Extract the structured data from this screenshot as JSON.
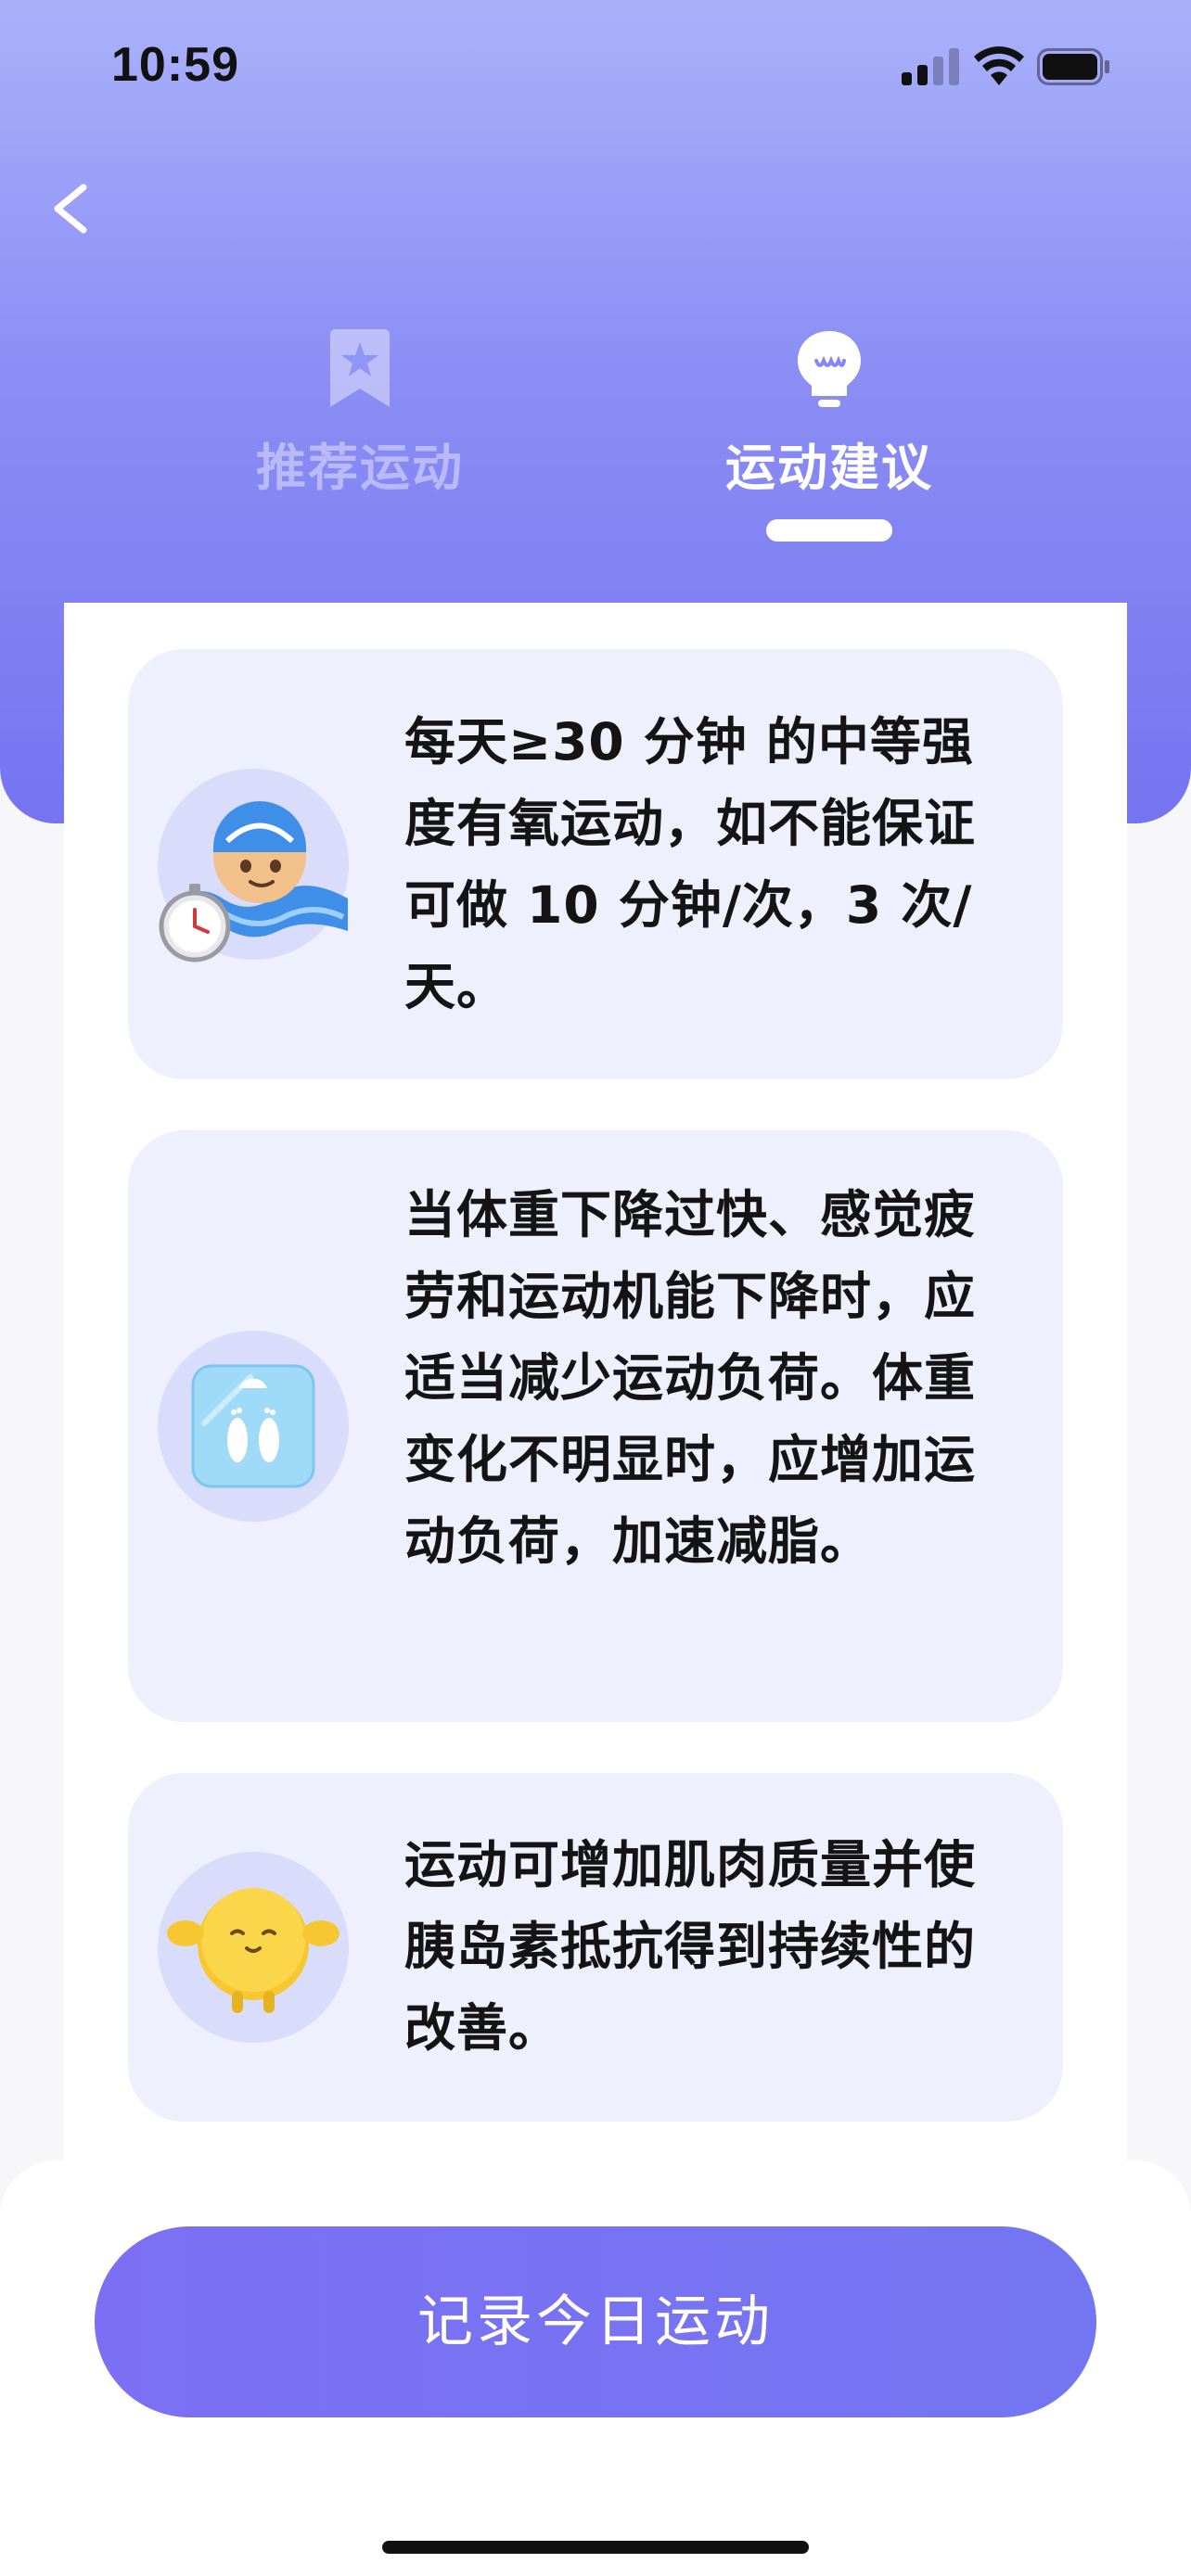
{
  "status_bar": {
    "time": "10:59"
  },
  "tabs": [
    {
      "label": "推荐运动",
      "icon": "bookmark-star-icon",
      "active": false
    },
    {
      "label": "运动建议",
      "icon": "lightbulb-icon",
      "active": true
    }
  ],
  "cards": [
    {
      "icon": "swimmer-stopwatch-icon",
      "text": "每天≥30 分钟 的中等强度有氧运动，如不能保证可做 10 分钟/次，3 次/天。"
    },
    {
      "icon": "weight-scale-icon",
      "text": "当体重下降过快、感觉疲劳和运动机能下降时，应适当减少运动负荷。体重变化不明显时，应增加运动负荷，加速减脂。"
    },
    {
      "icon": "muscle-character-icon",
      "text": "运动可增加肌肉质量并使胰岛素抵抗得到持续性的改善。"
    }
  ],
  "action": {
    "label": "记录今日运动"
  },
  "colors": {
    "header_gradient_top": "#aab1fa",
    "header_gradient_bottom": "#7574f1",
    "card_background": "#eef0fe",
    "button": "#7c6ff3"
  }
}
